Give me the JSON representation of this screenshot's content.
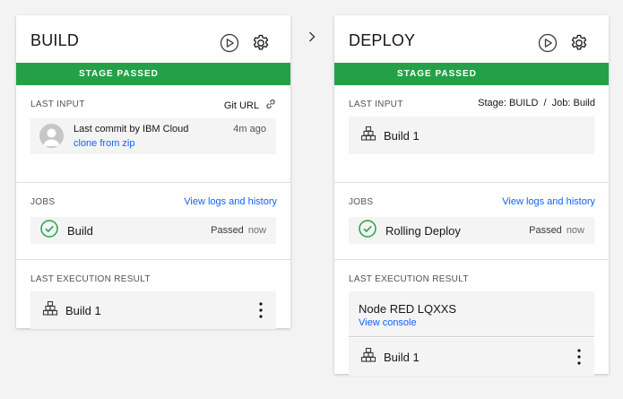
{
  "build": {
    "title": "BUILD",
    "banner": "STAGE PASSED",
    "last_input": {
      "label": "LAST INPUT",
      "source": "Git URL",
      "commit_text": "Last commit by IBM Cloud",
      "commit_time": "4m ago",
      "commit_link": "clone from zip"
    },
    "jobs": {
      "label": "JOBS",
      "link": "View logs and history",
      "job_name": "Build",
      "status": "Passed",
      "when": "now"
    },
    "result": {
      "label": "LAST EXECUTION RESULT",
      "build_label": "Build 1"
    }
  },
  "deploy": {
    "title": "DEPLOY",
    "banner": "STAGE PASSED",
    "last_input": {
      "label": "LAST INPUT",
      "source": "Stage: BUILD  /  Job: Build",
      "build_label": "Build 1"
    },
    "jobs": {
      "label": "JOBS",
      "link": "View logs and history",
      "job_name": "Rolling Deploy",
      "status": "Passed",
      "when": "now"
    },
    "result": {
      "label": "LAST EXECUTION RESULT",
      "app_name": "Node RED LQXXS",
      "console_link": "View console",
      "build_label": "Build 1"
    }
  },
  "colors": {
    "passed_green": "#24a148",
    "link_blue": "#0f62fe",
    "background": "#f3f3f3"
  },
  "icons": [
    "play-icon",
    "gear-icon",
    "link-icon",
    "user-avatar-icon",
    "checkmark-outline-icon",
    "build-blocks-icon",
    "overflow-menu-icon",
    "chevron-right-icon"
  ]
}
